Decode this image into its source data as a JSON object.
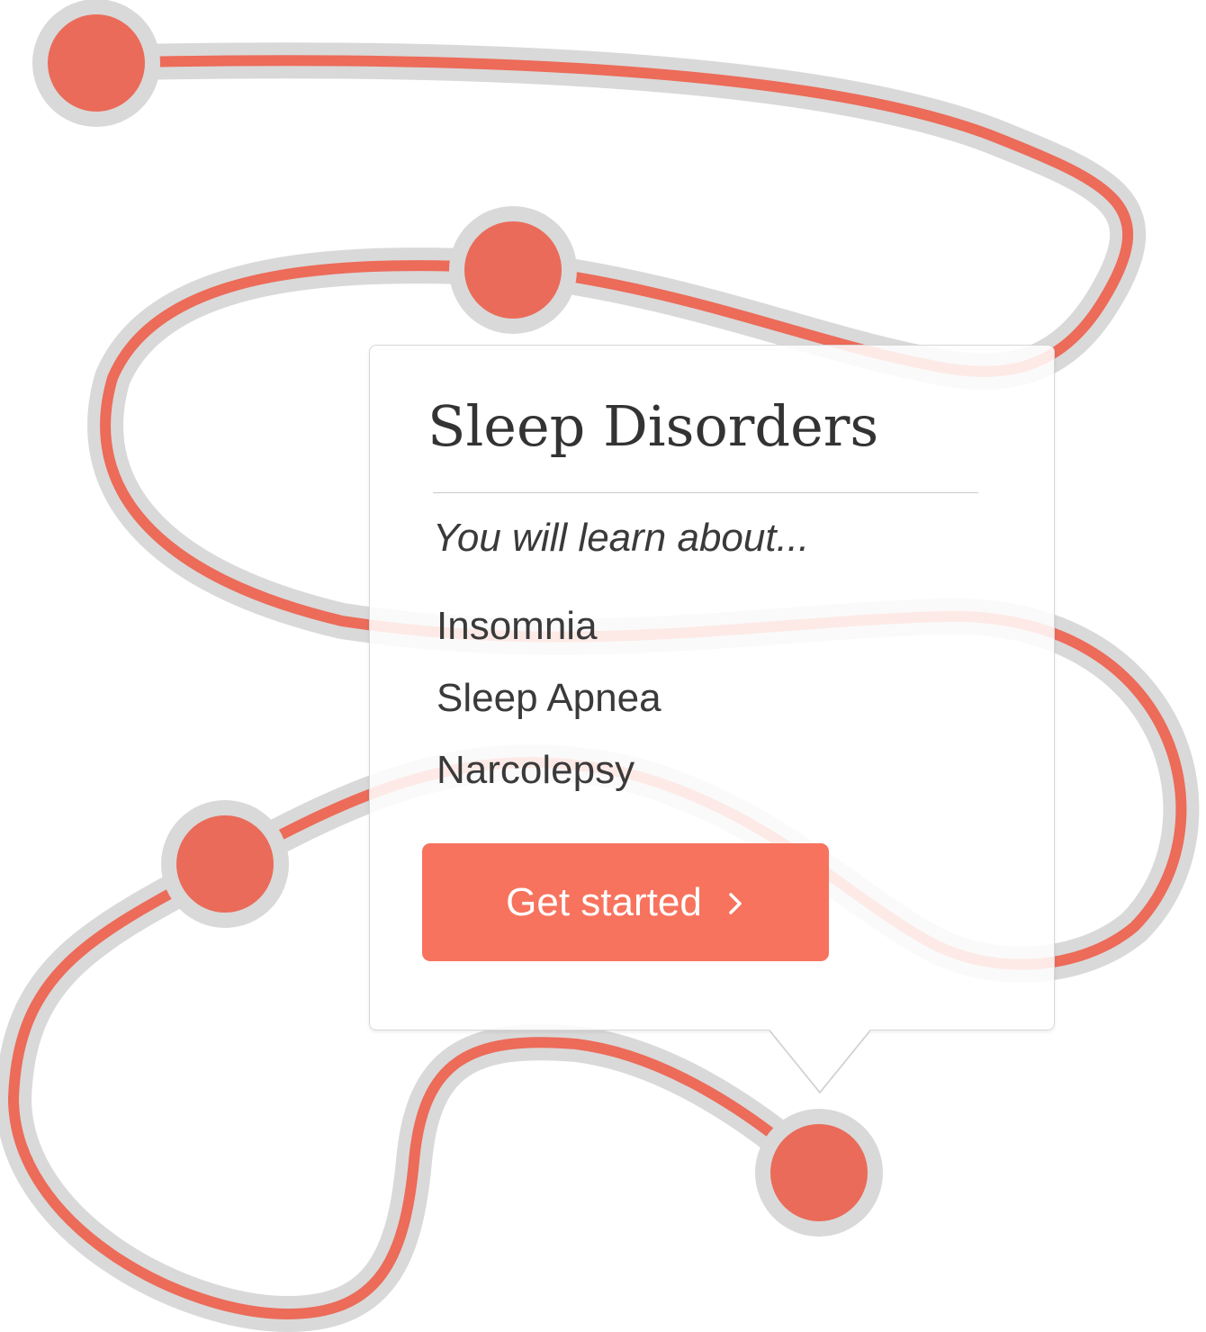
{
  "course": {
    "title": "Sleep Disorders",
    "subtitle": "You will learn about...",
    "topics": [
      "Insomnia",
      "Sleep Apnea",
      "Narcolepsy"
    ],
    "cta_label": "Get started",
    "cta_icon": "chevron-right-icon"
  },
  "path": {
    "milestones": [
      "milestone-1",
      "milestone-2",
      "milestone-3",
      "milestone-4"
    ],
    "active_milestone": "milestone-4"
  },
  "colors": {
    "path_line": "#ec6b59",
    "path_outline": "#d9d9d9",
    "milestone": "#ea6b59",
    "button": "#f7735e",
    "title_text": "#333333"
  }
}
